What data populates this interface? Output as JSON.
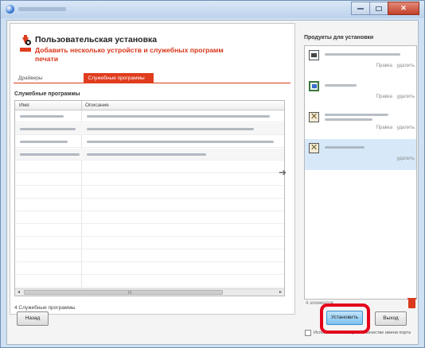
{
  "window": {
    "close_glyph": "✕"
  },
  "header": {
    "title": "Пользовательская установка",
    "subtitle": "Добавить несколько устройств и служебных программ печати"
  },
  "tabs": [
    {
      "label": "Драйверы",
      "active": false
    },
    {
      "label": "Служебные программы",
      "active": true
    }
  ],
  "utilities": {
    "section_label": "Служебные программы",
    "columns": [
      "Имя",
      "Описание"
    ],
    "count_label": "4 Служебные программы",
    "scroll_left": "◂",
    "scroll_right": "▸",
    "scroll_grip": "III"
  },
  "transfer_arrow": "➜",
  "products": {
    "title": "Продукты для установки",
    "items": [
      {
        "icon": "printer-icon",
        "actions": [
          "Правка",
          "удалить"
        ],
        "selected": false
      },
      {
        "icon": "monitor-icon",
        "actions": [
          "Правка",
          "удалить"
        ],
        "selected": false
      },
      {
        "icon": "tools-icon",
        "actions": [
          "Правка",
          "удалить"
        ],
        "selected": false
      },
      {
        "icon": "tools-icon",
        "actions": [
          "удалить"
        ],
        "selected": true
      }
    ],
    "count_label": "4 элементов",
    "checkbox_label": "Использовать имя узла в качестве имени порта"
  },
  "buttons": {
    "back": "Назад",
    "install": "Установить",
    "exit": "Выход"
  },
  "colors": {
    "accent": "#e03c1e",
    "highlight": "#e3001b"
  }
}
